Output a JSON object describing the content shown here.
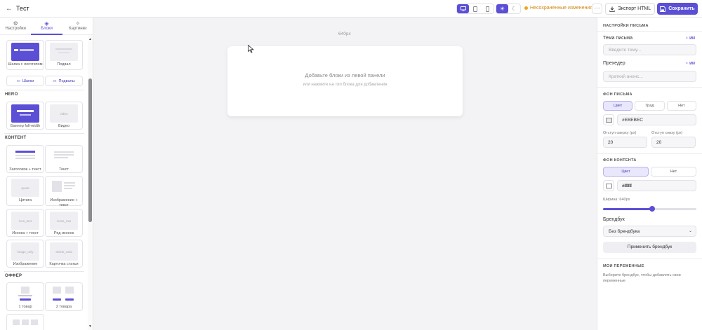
{
  "header": {
    "back_icon": "arrow-left-icon",
    "title": "Тест",
    "unsaved": "Несохранённые изменения",
    "more": "···",
    "export_label": "Экспорт HTML",
    "save_label": "Сохранить",
    "device": "desktop",
    "accent": "#5b4fd6"
  },
  "left": {
    "tabs": [
      {
        "label": "Настройки",
        "icon": "gear-icon"
      },
      {
        "label": "Блоки",
        "icon": "blocks-icon",
        "active": true
      },
      {
        "label": "Картинки",
        "icon": "sparkle-icon"
      }
    ],
    "cards_top": [
      {
        "label": "Шапка с логотипом"
      },
      {
        "label": "Подвал"
      }
    ],
    "pills": [
      {
        "label": "Шапки"
      },
      {
        "label": "Подвалы"
      }
    ],
    "sections": {
      "hero": "HERO",
      "content": "КОНТЕНТ",
      "offer": "ОФФЕР"
    },
    "hero_cards": [
      {
        "label": "Баннер full-width"
      },
      {
        "label": "Видео",
        "thumb": "video"
      }
    ],
    "content_cards": [
      {
        "label": "Заголовок + текст"
      },
      {
        "label": "Текст"
      },
      {
        "label": "Цитата",
        "thumb": "quote"
      },
      {
        "label": "Изображение + текст"
      },
      {
        "label": "Иконка + текст",
        "thumb": "icon_text"
      },
      {
        "label": "Ряд иконок",
        "thumb": "icons_row"
      },
      {
        "label": "Изображение",
        "thumb": "image_only"
      },
      {
        "label": "Карточка статьи",
        "thumb": "article_card"
      }
    ],
    "offer_cards": [
      {
        "label": "1 товар"
      },
      {
        "label": "2 товара"
      }
    ]
  },
  "canvas": {
    "width_label": "640px",
    "empty_title": "Добавьте блоки из левой панели",
    "empty_sub": "или нажмите на тип блока для добавления"
  },
  "right": {
    "email_settings": "НАСТРОЙКИ ПИСЬМА",
    "subject_label": "Тема письма",
    "subject_placeholder": "Введите тему...",
    "preheader_label": "Прехедер",
    "preheader_placeholder": "Краткий анонс...",
    "ai_link": "ИИ",
    "bg_section": "ФОН ПИСЬМА",
    "bg_options": [
      "Цвет",
      "Град",
      "Нет"
    ],
    "bg_color": "#EBEBEC",
    "padding_top_label": "Отступ сверху (px)",
    "padding_bottom_label": "Отступ снизу (px)",
    "padding_top": "20",
    "padding_bottom": "20",
    "content_bg_section": "ФОН КОНТЕНТА",
    "content_bg_options": [
      "Цвет",
      "Нет"
    ],
    "content_bg_color": "#ffffff",
    "width_label": "Ширина: 640px",
    "width_fraction": 0.53,
    "brandbook_label": "Брендбук",
    "brandbook_value": "Без брендбука",
    "apply_brandbook": "Применить брендбук",
    "my_vars": "МОИ ПЕРЕМЕННЫЕ",
    "my_vars_note": "Выберите брендбук, чтобы добавлять свои переменные"
  }
}
